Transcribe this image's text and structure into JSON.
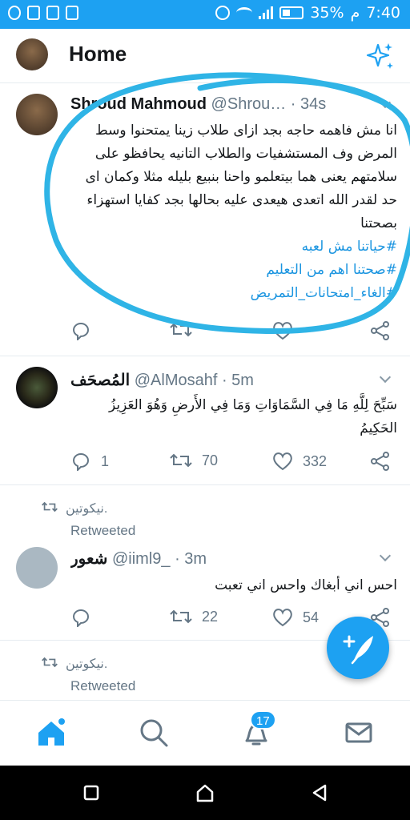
{
  "status_bar": {
    "time": "7:40",
    "ampm": "م",
    "battery": "35%"
  },
  "header": {
    "title": "Home",
    "sparkle_icon": "sparkle-icon"
  },
  "tweets": [
    {
      "name": "Shroud Mahmoud",
      "handle": "@Shrou…",
      "time": "· 34s",
      "body": "انا مش فاهمه حاجه بجد ازاى طلاب زينا يمتحنوا وسط المرض وف المستشفيات والطلاب التانيه يحافظو على سلامتهم يعنى هما بيتعلمو واحنا بنبيع بليله مثلا وكمان اى حد لقدر الله اتعدى هيعدى عليه بحالها بجد كفايا استهزاء بصحتنا",
      "hashtag_lines": [
        "#حياتنا مش لعبه",
        "#صحتنا اهم  من التعليم",
        "#الغاء_امتحانات_التمريض"
      ],
      "counts": {
        "reply": "",
        "retweet": "",
        "like": ""
      }
    },
    {
      "name": "المُصحَف",
      "handle": "@AlMosahf",
      "time": "· 5m",
      "body": "سَبِّحَ لِلَّهِ مَا فِي السَّمَاوَاتِ وَمَا فِي الأَرضِ وَهُوَ العَزِيزُ الحَكِيمُ",
      "counts": {
        "reply": "1",
        "retweet": "70",
        "like": "332"
      }
    },
    {
      "retweeted_by": "نيكوتين.",
      "retweeted_label": "Retweeted",
      "name": "شعور",
      "handle": "@iiml9_",
      "time": "· 3m",
      "body": "احس اني أبغاك واحس اني تعبت",
      "counts": {
        "reply": "",
        "retweet": "22",
        "like": "54"
      }
    },
    {
      "retweeted_by": "نيكوتين.",
      "retweeted_label": "Retweeted"
    }
  ],
  "bottom_nav": {
    "notifications_badge": "17"
  },
  "colors": {
    "accent": "#1da1f2",
    "link": "#1b95e0",
    "muted": "#657786",
    "annotation": "#2fb4e6"
  }
}
